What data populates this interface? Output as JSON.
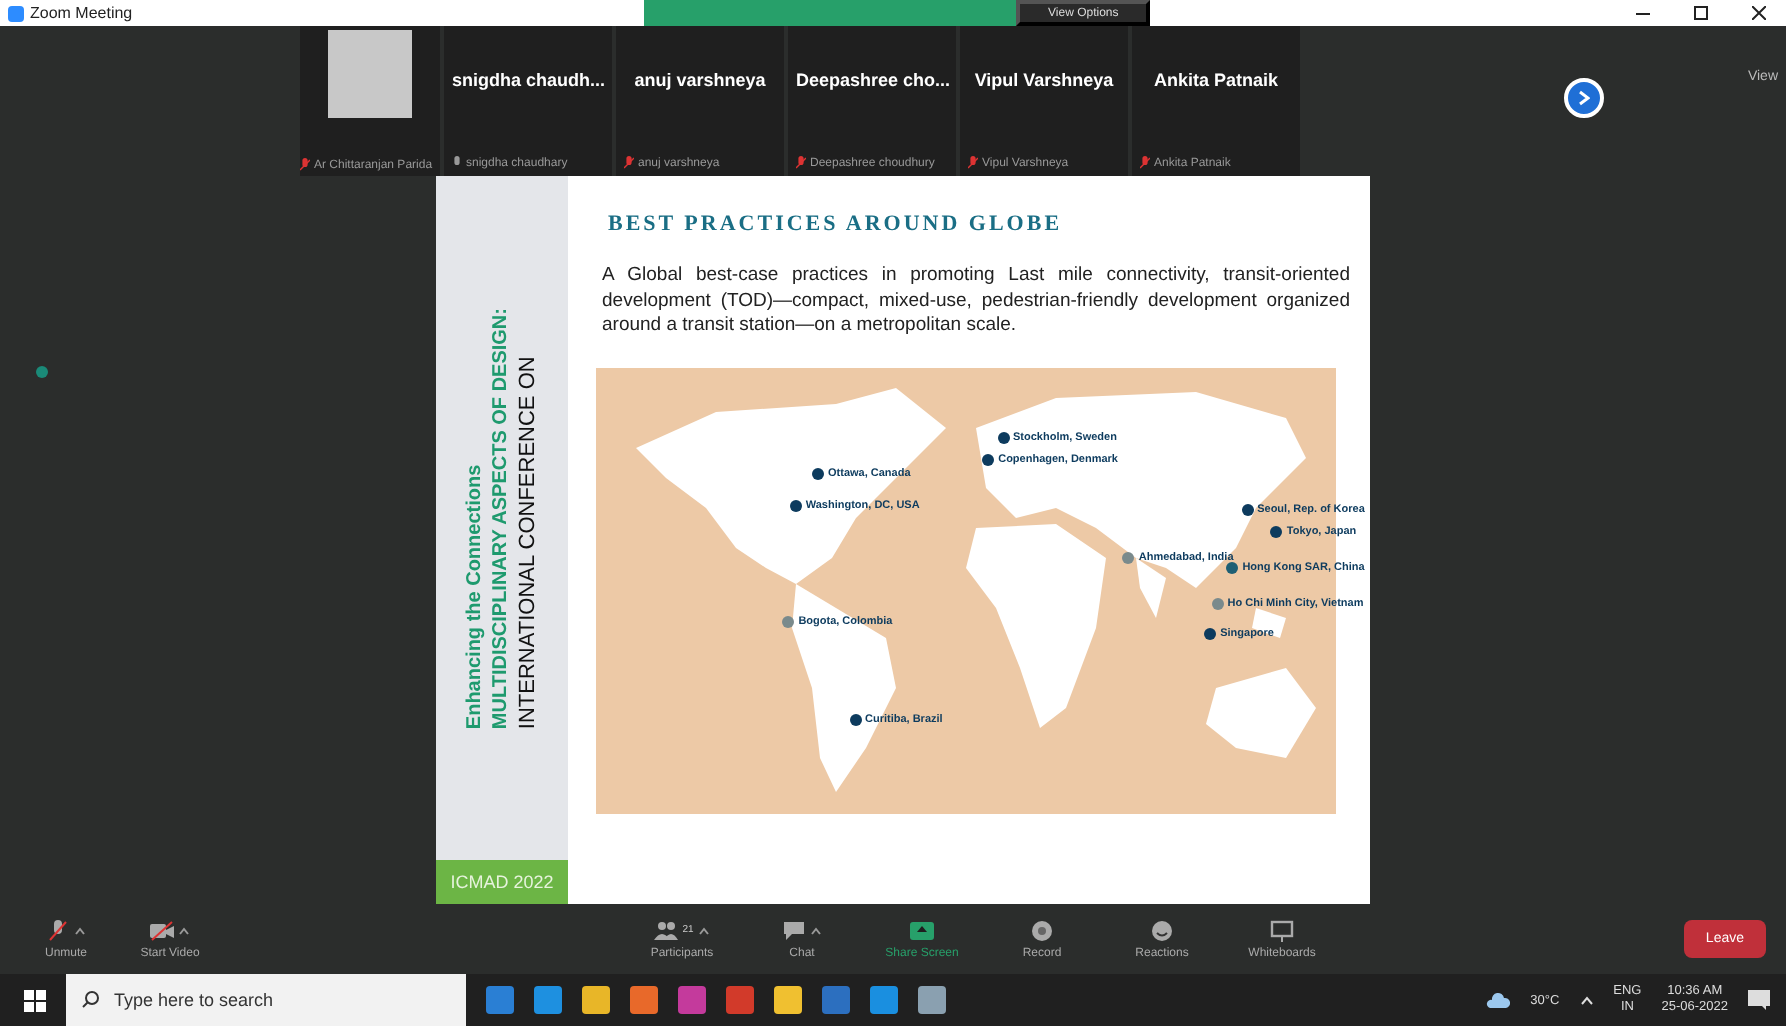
{
  "window": {
    "title": "Zoom Meeting",
    "view_options": "View Options",
    "view": "View"
  },
  "participants": [
    {
      "name": "Ar Chittaranjan Parida",
      "video": true,
      "muted": true
    },
    {
      "tile_name": "snigdha  chaudh...",
      "name": "snigdha chaudhary",
      "video": false,
      "muted": false
    },
    {
      "tile_name": "anuj varshneya",
      "name": "anuj varshneya",
      "video": false,
      "muted": true
    },
    {
      "tile_name": "Deepashree  cho...",
      "name": "Deepashree choudhury",
      "video": false,
      "muted": true
    },
    {
      "tile_name": "Vipul Varshneya",
      "name": "Vipul Varshneya",
      "video": false,
      "muted": true
    },
    {
      "tile_name": "Ankita Patnaik",
      "name": "Ankita Patnaik",
      "video": false,
      "muted": true
    }
  ],
  "slide": {
    "side_lines": [
      "INTERNATIONAL CONFERENCE ON",
      "MULTIDISCIPLINARY ASPECTS OF DESIGN:",
      "Enhancing the Connections"
    ],
    "badge": "ICMAD 2022",
    "heading": "BEST PRACTICES AROUND GLOBE",
    "body": "A Global best-case practices in promoting Last mile connectivity, transit-oriented development (TOD)—compact, mixed-use, pedestrian-friendly development organized around a transit station—on a metropolitan scale.",
    "cities": [
      {
        "label": "Ottawa, Canada",
        "color": "#0d3b5e"
      },
      {
        "label": "Washington, DC, USA",
        "color": "#0d3b5e"
      },
      {
        "label": "Stockholm, Sweden",
        "color": "#0d3b5e"
      },
      {
        "label": "Copenhagen, Denmark",
        "color": "#0d3b5e"
      },
      {
        "label": "Seoul, Rep. of Korea",
        "color": "#0d3b5e"
      },
      {
        "label": "Tokyo, Japan",
        "color": "#0d3b5e"
      },
      {
        "label": "Hong Kong SAR, China",
        "color": "#1e5f74"
      },
      {
        "label": "Ho Chi Minh City, Vietnam",
        "color": "#7a8a8c"
      },
      {
        "label": "Singapore",
        "color": "#0d3b5e"
      },
      {
        "label": "Ahmedabad, India",
        "color": "#7a8a8c"
      },
      {
        "label": "Bogota, Colombia",
        "color": "#7a8a8c"
      },
      {
        "label": "Curitiba, Brazil",
        "color": "#0d3b5e"
      }
    ]
  },
  "toolbar": [
    {
      "label": "Unmute",
      "kind": "mic",
      "caret": true
    },
    {
      "label": "Start Video",
      "kind": "video",
      "caret": true
    },
    {
      "label": "Participants",
      "kind": "people",
      "caret": true,
      "count": "21"
    },
    {
      "label": "Chat",
      "kind": "chat",
      "caret": true
    },
    {
      "label": "Share Screen",
      "kind": "share",
      "caret": false
    },
    {
      "label": "Record",
      "kind": "record",
      "caret": false
    },
    {
      "label": "Reactions",
      "kind": "react",
      "caret": false
    },
    {
      "label": "Whiteboards",
      "kind": "board",
      "caret": false
    }
  ],
  "leave": "Leave",
  "taskbar": {
    "search_placeholder": "Type here to search",
    "weather": "30°C",
    "language": "ENG",
    "region": "IN",
    "time": "10:36 AM",
    "date": "25-06-2022"
  }
}
